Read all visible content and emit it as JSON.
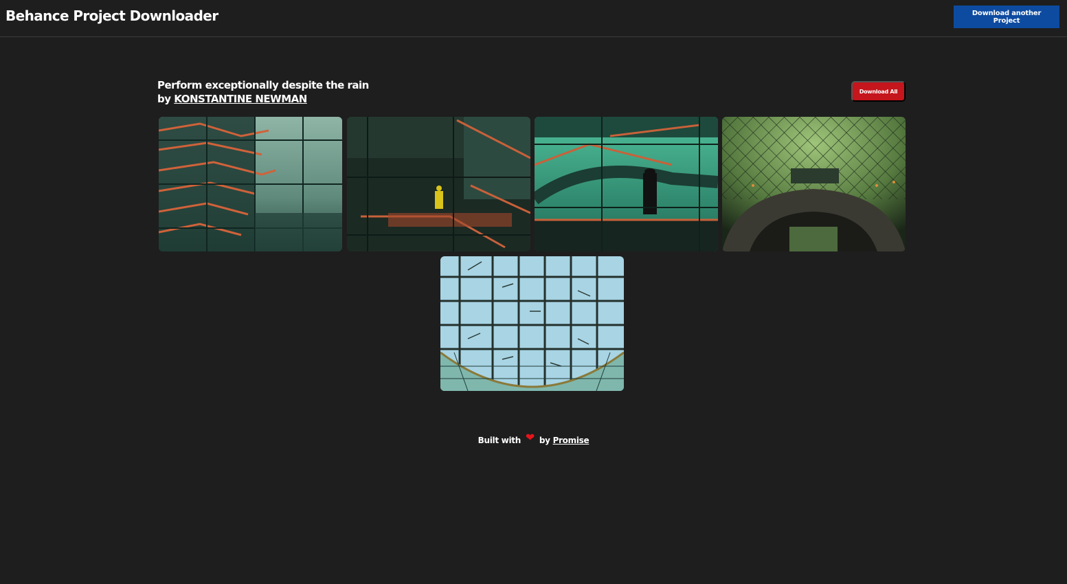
{
  "header": {
    "title": "Behance Project Downloader",
    "another_button_label": "Download another Project"
  },
  "project": {
    "title": "Perform exceptionally despite the rain",
    "by_prefix": "by",
    "author": "KONSTANTINE NEWMAN",
    "download_all_label": "Download All"
  },
  "gallery": {
    "images": [
      {
        "name": "staircase-window"
      },
      {
        "name": "orange-stairs-figure"
      },
      {
        "name": "teal-staircase-silhouette"
      },
      {
        "name": "green-dome-interior"
      },
      {
        "name": "skylight-grid"
      }
    ]
  },
  "footer": {
    "built_with": "Built with",
    "heart": "❤",
    "by": "by",
    "author_link": "Promise"
  },
  "colors": {
    "background": "#1e1e1e",
    "primary_button": "#0d4ba0",
    "download_all_button": "#c4161c",
    "heart": "#e8141b"
  }
}
